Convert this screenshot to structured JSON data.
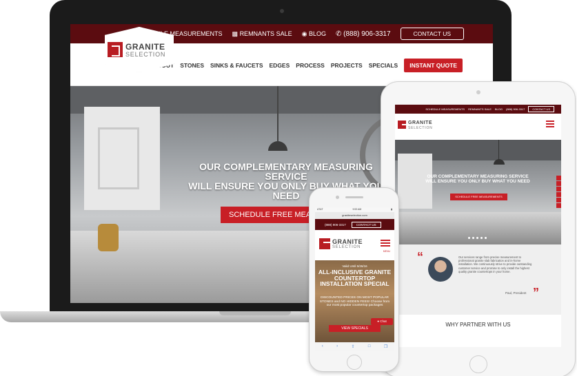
{
  "colors": {
    "brand_dark": "#5b0c10",
    "accent_red": "#c81f26"
  },
  "logo": {
    "line1": "GRANITE",
    "line2": "SELECTION"
  },
  "laptop": {
    "topbar": {
      "schedule": "SCHEDULE MEASUREMENTS",
      "remnants": "REMNANTS SALE",
      "blog": "BLOG",
      "phone": "(888) 906-3317",
      "contact": "CONTACT US"
    },
    "nav": [
      "ABOUT",
      "STONES",
      "SINKS & FAUCETS",
      "EDGES",
      "PROCESS",
      "PROJECTS",
      "SPECIALS"
    ],
    "quote_button": "INSTANT QUOTE",
    "hero": {
      "line1": "OUR COMPLEMENTARY MEASURING SERVICE",
      "line2": "WILL ENSURE YOU ONLY BUY WHAT YOU NEED",
      "button": "SCHEDULE FREE MEASUREMENTS"
    }
  },
  "tablet": {
    "topbar": {
      "schedule": "SCHEDULE MEASUREMENTS",
      "remnants": "REMNANTS SALE",
      "blog": "BLOG",
      "phone": "(888) 906-3317",
      "contact": "CONTACT US"
    },
    "hero": {
      "line1": "OUR COMPLEMENTARY MEASURING SERVICE",
      "line2": "WILL ENSURE YOU ONLY BUY WHAT YOU NEED",
      "button": "SCHEDULE FREE MEASUREMENTS"
    },
    "testimonial": {
      "text": "Our services range from precise measurement to professional granite slab fabrication and in-home installation. We continuously strive to provide outstanding customer service and promise to only install the highest quality granite countertops in your home.",
      "signature": "Paul, President"
    },
    "section_heading": "WHY PARTNER WITH US"
  },
  "phone": {
    "status": {
      "carrier": "AT&T",
      "time": "9:53 AM"
    },
    "url": "graniteselection.com",
    "phone_number": "(888) 906-3317",
    "contact": "CONTACT US",
    "menu_label": "MENU",
    "hero": {
      "valid": "Valid Until 5/26/16",
      "title": "ALL-INCLUSIVE GRANITE COUNTERTOP INSTALLATION SPECIAL",
      "sub": "DISCOUNTED PRICES ON MOST POPULAR STONES and NO HIDDEN FEES! Choose from our most popular countertop packages",
      "button": "VIEW SPECIALS",
      "chat": "Chat"
    }
  }
}
